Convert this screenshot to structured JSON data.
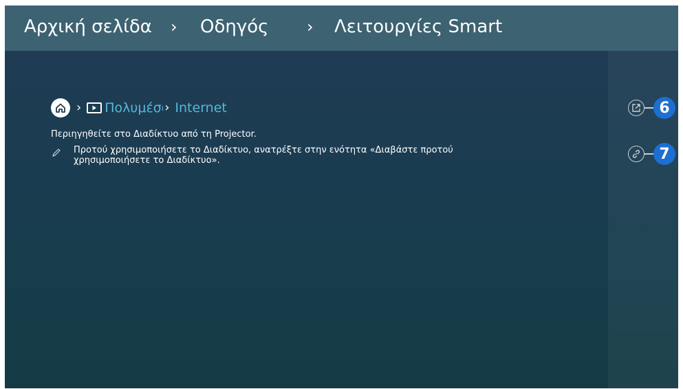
{
  "header": {
    "crumb_home": "Αρχική σελίδα",
    "crumb_guide": "Οδηγός",
    "crumb_smart": "Λειτουργίες Smart",
    "separator": "›"
  },
  "path": {
    "icons": [
      "home-icon",
      "media-icon"
    ],
    "media_label": "Πολυμέσα",
    "internet_label": "Internet",
    "chevron": "›"
  },
  "content": {
    "description": "Περιηγηθείτε στο Διαδίκτυο από τη Projector.",
    "note": "Προτού χρησιμοποιήσετε το Διαδίκτυο, ανατρέξτε στην ενότητα «Διαβάστε προτού χρησιμοποιήσετε το Διαδίκτυο»."
  },
  "callouts": {
    "open_badge": "6",
    "link_badge": "7",
    "icons": [
      "open-external-icon",
      "link-icon"
    ]
  },
  "colors": {
    "accent": "#57b8d8",
    "badge": "#1d6fd1",
    "topbar": "#3d6272"
  }
}
